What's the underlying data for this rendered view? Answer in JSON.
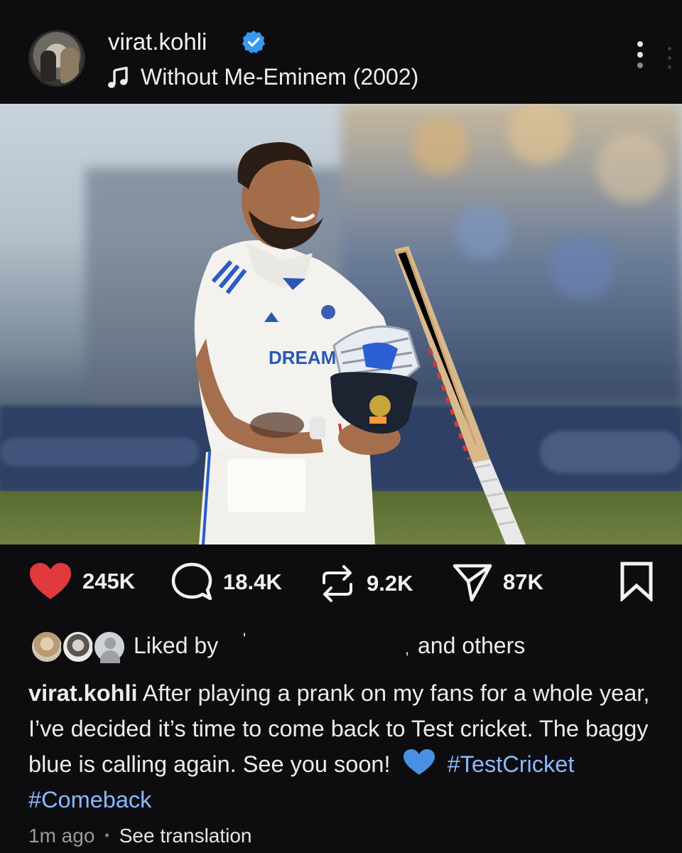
{
  "header": {
    "username": "virat.kohli",
    "song": "Without Me-Eminem (2002)",
    "icons": {
      "verified": "verified-badge-icon",
      "music": "music-note-icon",
      "more": "more-options-icon"
    },
    "verified_color": "#3897f0"
  },
  "post_image": {
    "jersey_text": "DREAM",
    "sound_icon": "speaker-icon"
  },
  "actions": {
    "like_count": "245K",
    "comment_count": "18.4K",
    "repost_count": "9.2K",
    "share_count": "87K",
    "like_color": "#e0393e",
    "icons": [
      "heart-icon",
      "comment-icon",
      "repost-icon",
      "share-icon",
      "bookmark-icon"
    ]
  },
  "likes": {
    "prefix": "Liked by",
    "mark": "'",
    "separator": ",",
    "suffix": "and others"
  },
  "caption": {
    "username": "virat.kohli",
    "text": "After playing a prank on my fans for a whole year, I’ve decided it’s time to come back to Test cricket. The baggy blue is calling again. See you soon!",
    "hashtags": [
      "#TestCricket",
      "#Comeback"
    ],
    "hashtag_color": "#8bb8ff"
  },
  "meta": {
    "time": "1m ago",
    "dot": "•",
    "translate": "See translation"
  }
}
